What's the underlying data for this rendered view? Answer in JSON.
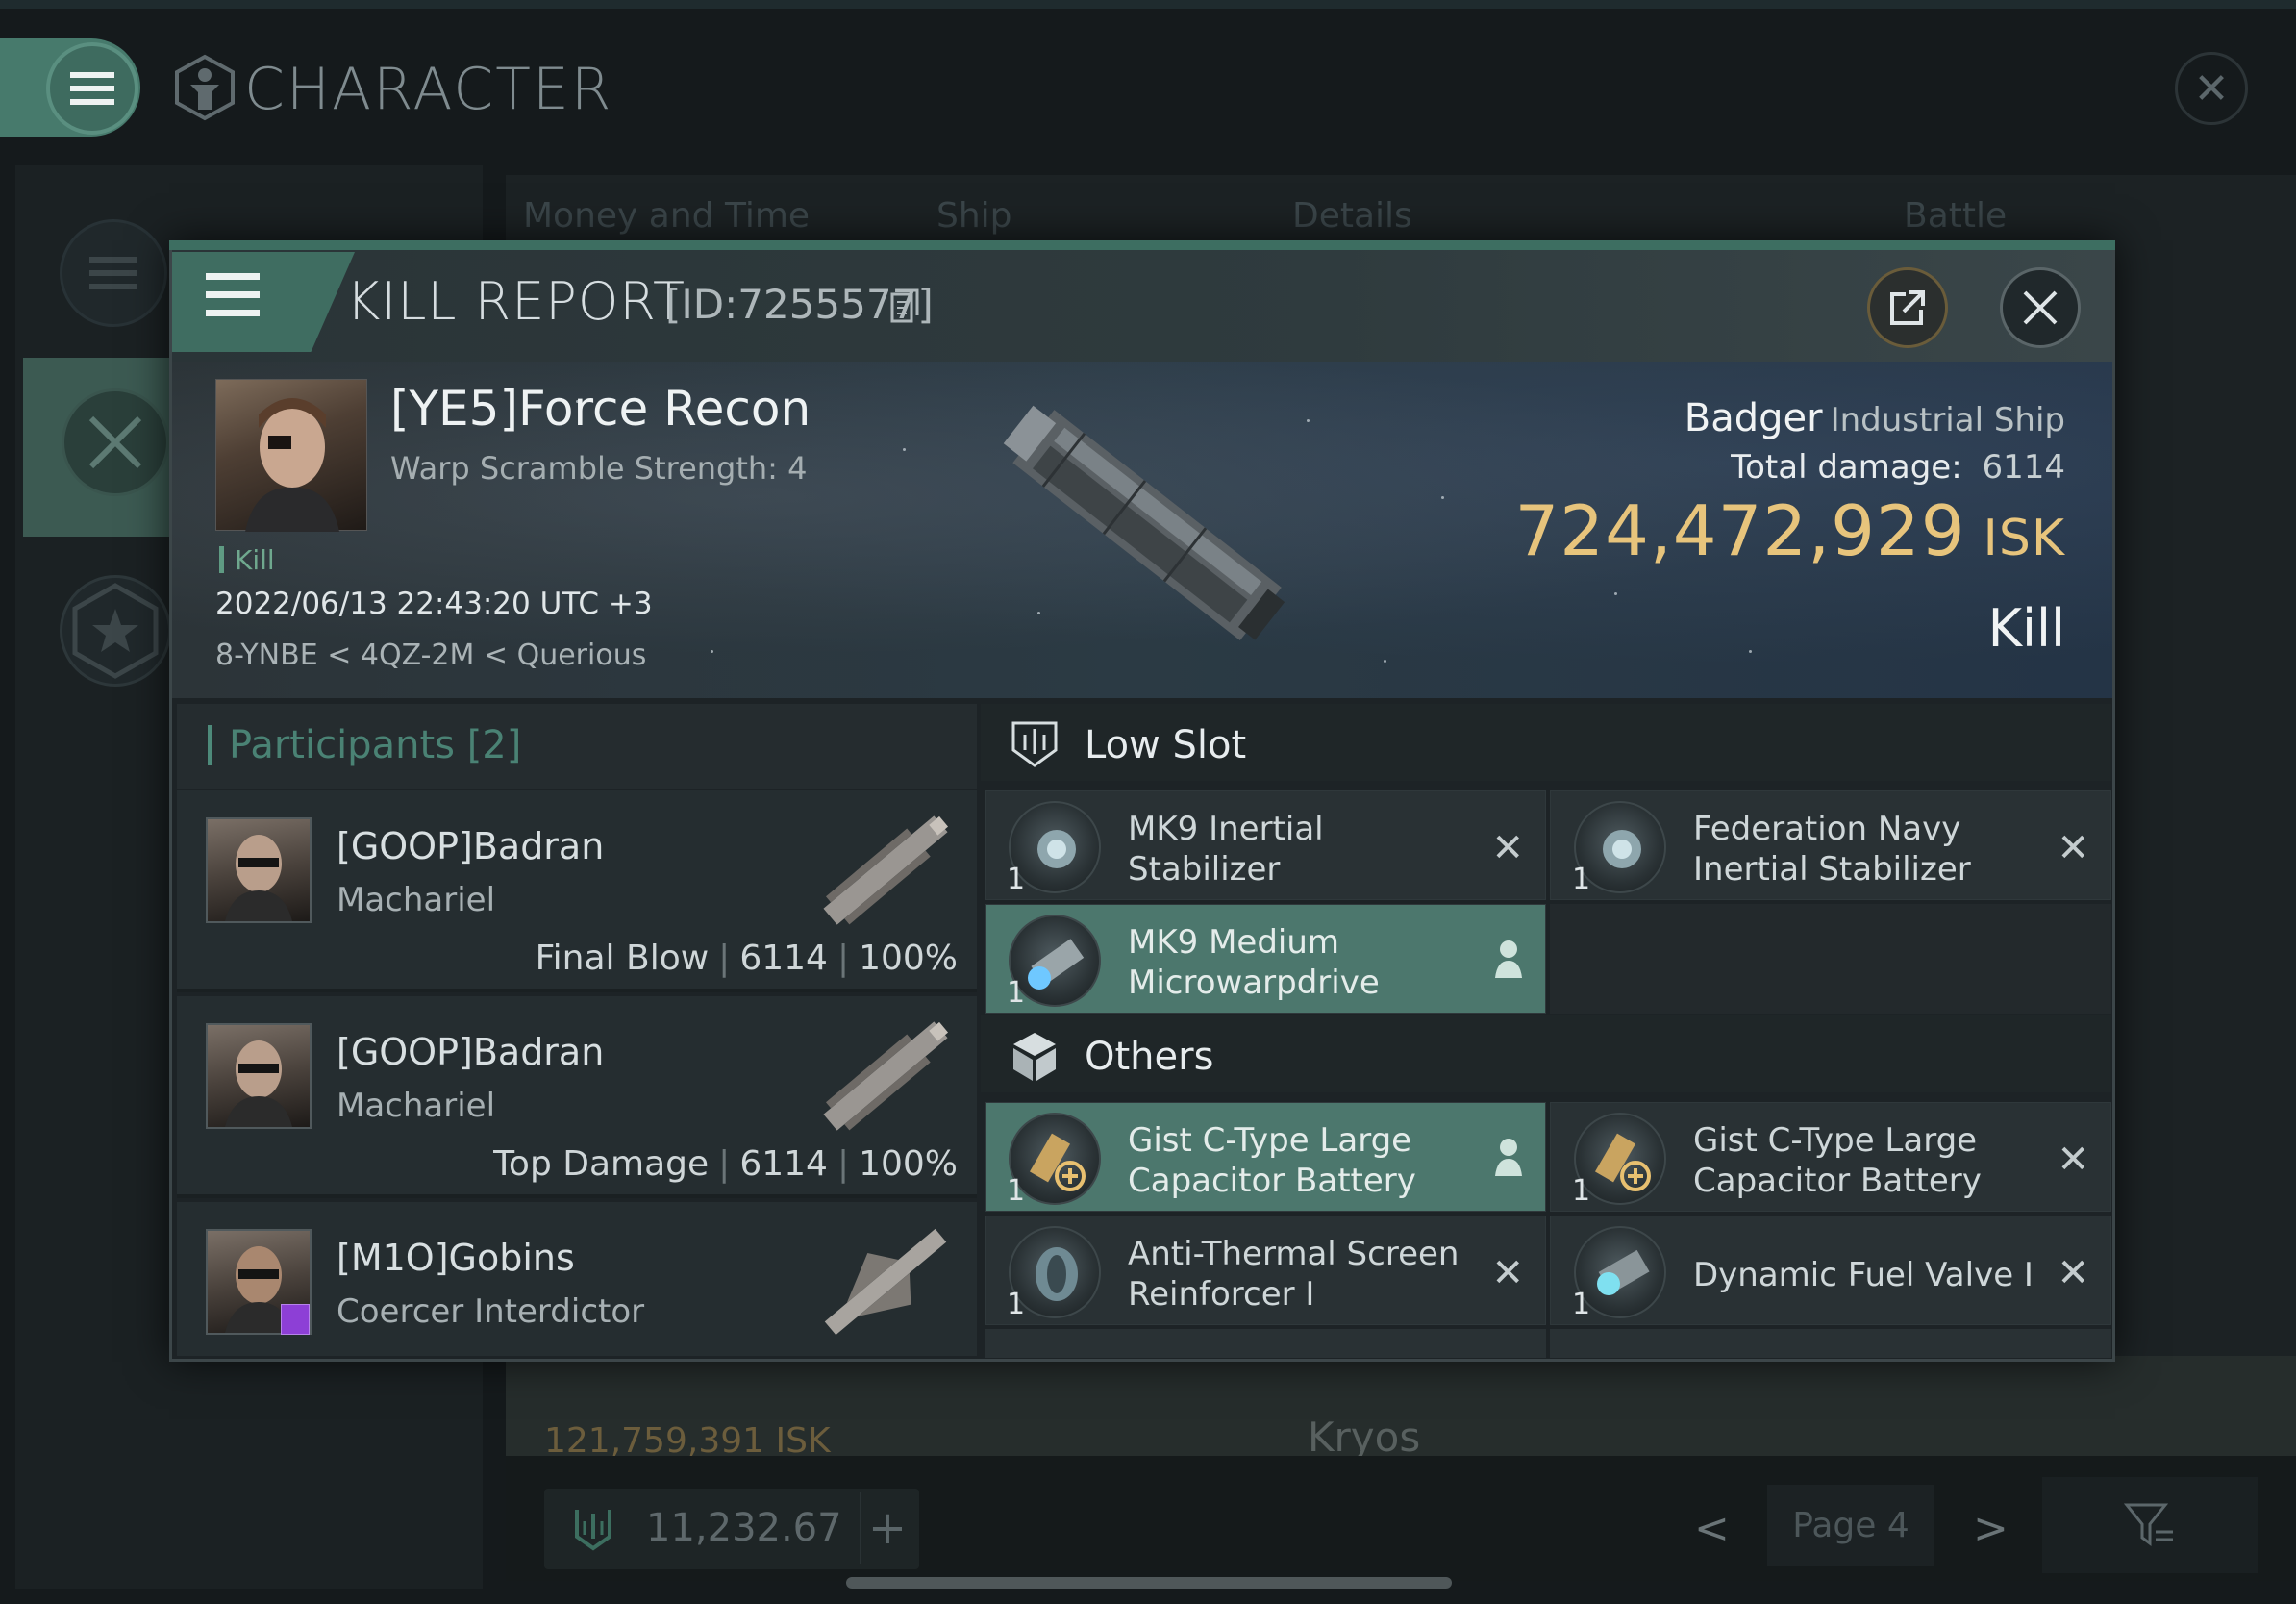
{
  "background_window": {
    "title": "CHARACTER",
    "tabs": [
      "Money and Time",
      "Ship",
      "Details",
      "Battle Status"
    ],
    "bottom_row": {
      "isk": "121,759,391  ISK",
      "ship": "Kryos"
    },
    "wallet": {
      "value": "11,232.67",
      "plus": "+"
    },
    "pagination": {
      "prev": "<",
      "page": "Page 4",
      "next": ">"
    }
  },
  "kill_report": {
    "title": "KILL REPORT",
    "id": "[ID:7255577]",
    "victim": {
      "name": "[YE5]Force Recon",
      "subtitle": "Warp Scramble Strength: 4",
      "tag": "Kill",
      "datetime": "2022/06/13 22:43:20 UTC +3",
      "location": "8-YNBE < 4QZ-2M < Querious"
    },
    "ship": {
      "name": "Badger",
      "class": "Industrial Ship",
      "total_damage_label": "Total damage:",
      "total_damage": "6114",
      "isk_value": "724,472,929",
      "isk_unit": "ISK",
      "result": "Kill"
    },
    "participants": {
      "title": "Participants",
      "count": "[2]",
      "items": [
        {
          "name": "[GOOP]Badran",
          "ship": "Machariel",
          "role": "Final Blow",
          "damage": "6114",
          "percent": "100%"
        },
        {
          "name": "[GOOP]Badran",
          "ship": "Machariel",
          "role": "Top Damage",
          "damage": "6114",
          "percent": "100%"
        },
        {
          "name": "[M1O]Gobins",
          "ship": "Coercer Interdictor"
        }
      ]
    },
    "fitting": {
      "low_slot": {
        "title": "Low Slot",
        "items": [
          {
            "name": "MK9 Inertial Stabilizer",
            "qty": "1",
            "status": "x"
          },
          {
            "name": "Federation Navy Inertial Stabilizer",
            "qty": "1",
            "status": "x"
          },
          {
            "name": "MK9 Medium Microwarpdrive",
            "qty": "1",
            "status": "dropped"
          }
        ]
      },
      "others": {
        "title": "Others",
        "items": [
          {
            "name": "Gist C-Type Large Capacitor Battery",
            "qty": "1",
            "status": "dropped"
          },
          {
            "name": "Gist C-Type Large Capacitor Battery",
            "qty": "1",
            "status": "x"
          },
          {
            "name": "Anti-Thermal Screen Reinforcer I",
            "qty": "1",
            "status": "x"
          },
          {
            "name": "Dynamic Fuel Valve I",
            "qty": "1",
            "status": "x"
          }
        ]
      }
    }
  },
  "colors": {
    "accent": "#477a6c",
    "isk": "#e7c47c",
    "active_item": "#4c776d"
  }
}
